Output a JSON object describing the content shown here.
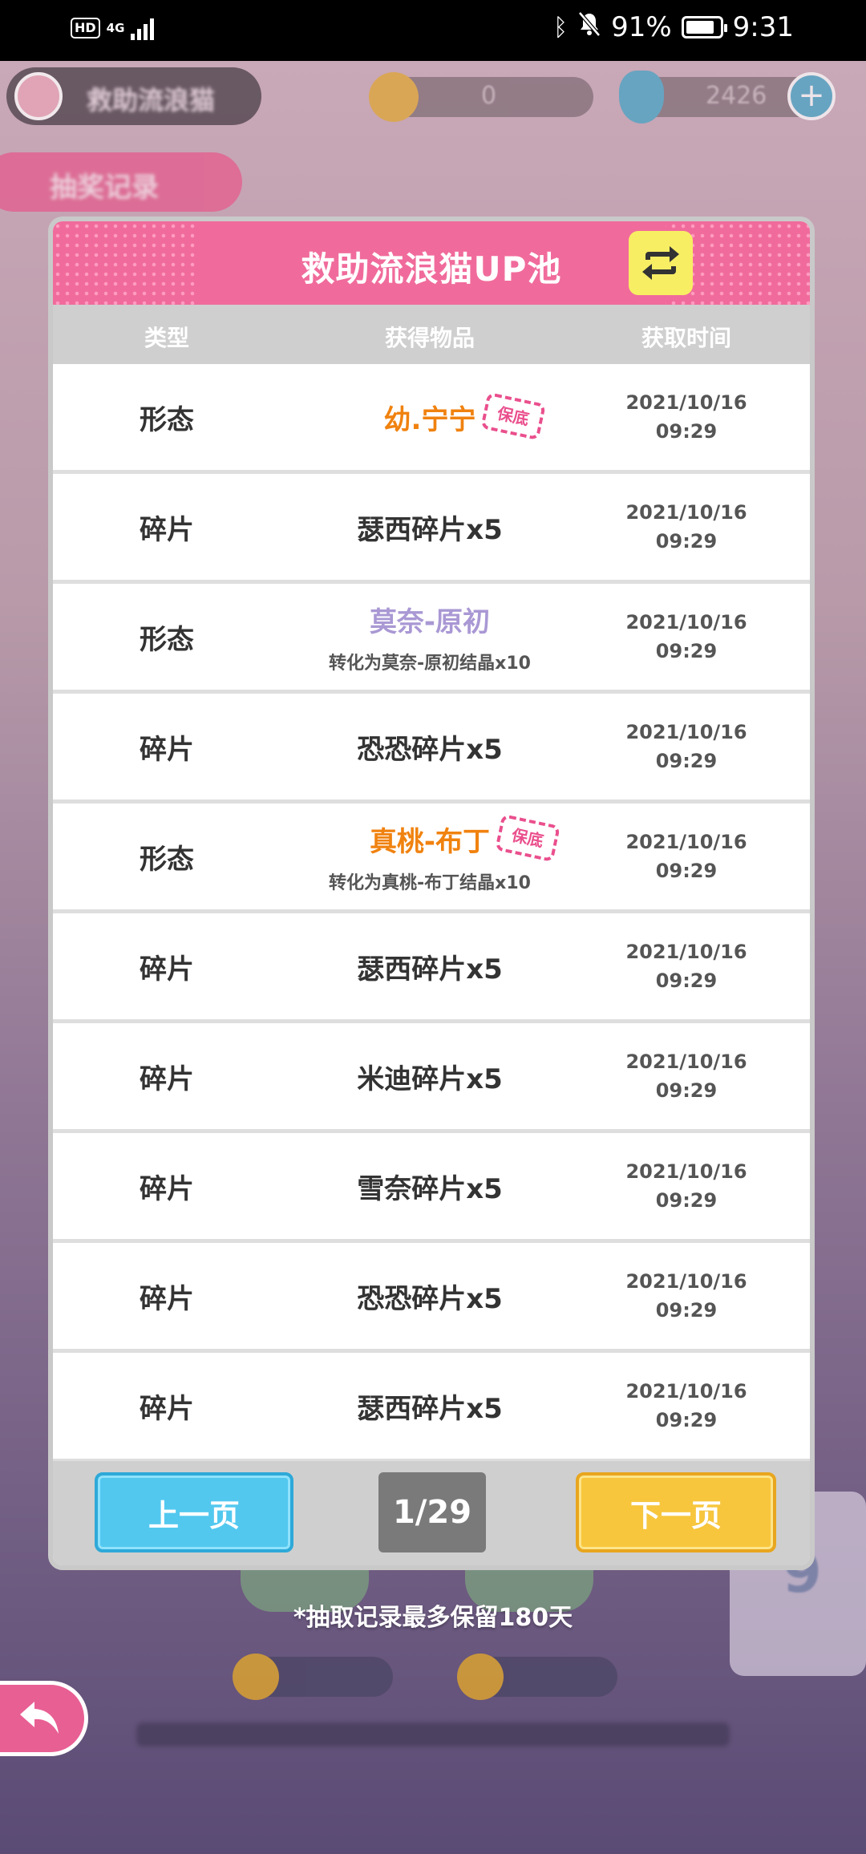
{
  "status_bar": {
    "hd": "HD",
    "network": "4G",
    "battery_percent": "91%",
    "time": "9:31",
    "icons": [
      "bluetooth-icon",
      "bell-muted-icon",
      "battery-icon"
    ]
  },
  "background": {
    "pool_name": "救助流浪猫",
    "coin_count": "0",
    "gem_count": "2426",
    "record_button": "抽奖记录",
    "card_number": "9"
  },
  "panel": {
    "title": "救助流浪猫UP池",
    "switch_icon": "switch-arrows-icon",
    "columns": {
      "type": "类型",
      "item": "获得物品",
      "time": "获取时间"
    },
    "rows": [
      {
        "type": "形态",
        "item": "幼.宁宁",
        "item_color": "orange",
        "guarantee": "保底",
        "sub": "",
        "date": "2021/10/16",
        "time": "09:29"
      },
      {
        "type": "碎片",
        "item": "瑟西碎片x5",
        "item_color": "default",
        "guarantee": "",
        "sub": "",
        "date": "2021/10/16",
        "time": "09:29"
      },
      {
        "type": "形态",
        "item": "莫奈-原初",
        "item_color": "purple",
        "guarantee": "",
        "sub": "转化为莫奈-原初结晶x10",
        "date": "2021/10/16",
        "time": "09:29"
      },
      {
        "type": "碎片",
        "item": "恐恐碎片x5",
        "item_color": "default",
        "guarantee": "",
        "sub": "",
        "date": "2021/10/16",
        "time": "09:29"
      },
      {
        "type": "形态",
        "item": "真桃-布丁",
        "item_color": "orange",
        "guarantee": "保底",
        "sub": "转化为真桃-布丁结晶x10",
        "date": "2021/10/16",
        "time": "09:29"
      },
      {
        "type": "碎片",
        "item": "瑟西碎片x5",
        "item_color": "default",
        "guarantee": "",
        "sub": "",
        "date": "2021/10/16",
        "time": "09:29"
      },
      {
        "type": "碎片",
        "item": "米迪碎片x5",
        "item_color": "default",
        "guarantee": "",
        "sub": "",
        "date": "2021/10/16",
        "time": "09:29"
      },
      {
        "type": "碎片",
        "item": "雪奈碎片x5",
        "item_color": "default",
        "guarantee": "",
        "sub": "",
        "date": "2021/10/16",
        "time": "09:29"
      },
      {
        "type": "碎片",
        "item": "恐恐碎片x5",
        "item_color": "default",
        "guarantee": "",
        "sub": "",
        "date": "2021/10/16",
        "time": "09:29"
      },
      {
        "type": "碎片",
        "item": "瑟西碎片x5",
        "item_color": "default",
        "guarantee": "",
        "sub": "",
        "date": "2021/10/16",
        "time": "09:29"
      }
    ],
    "pagination": {
      "prev_label": "上一页",
      "next_label": "下一页",
      "indicator": "1/29"
    }
  },
  "note": "*抽取记录最多保留180天",
  "back_icon": "back-arrow-icon",
  "colors": {
    "header_pink": "#f06b9b",
    "orange_item": "#f0820f",
    "purple_item": "#a998d4",
    "prev_blue": "#53c8ef",
    "next_yellow": "#f7c63d",
    "stamp_pink": "#ea4f8d"
  }
}
